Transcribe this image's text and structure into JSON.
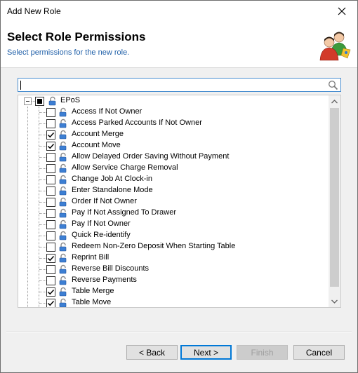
{
  "window": {
    "title": "Add New Role"
  },
  "header": {
    "title": "Select Role Permissions",
    "subtitle": "Select permissions for the new role.",
    "icon": "users-role-icon"
  },
  "search": {
    "value": "",
    "icon": "search-icon"
  },
  "tree": {
    "root": {
      "label": "EPoS",
      "expanded": true,
      "check_state": "partial"
    },
    "items": [
      {
        "label": "Access If Not Owner",
        "checked": false
      },
      {
        "label": "Access Parked Accounts If Not Owner",
        "checked": false
      },
      {
        "label": "Account Merge",
        "checked": true
      },
      {
        "label": "Account Move",
        "checked": true
      },
      {
        "label": "Allow Delayed Order Saving Without Payment",
        "checked": false
      },
      {
        "label": "Allow Service Charge Removal",
        "checked": false
      },
      {
        "label": "Change Job At Clock-in",
        "checked": false
      },
      {
        "label": "Enter Standalone Mode",
        "checked": false
      },
      {
        "label": "Order If Not Owner",
        "checked": false
      },
      {
        "label": "Pay If Not Assigned To Drawer",
        "checked": false
      },
      {
        "label": "Pay If Not Owner",
        "checked": false
      },
      {
        "label": "Quick Re-identify",
        "checked": false
      },
      {
        "label": "Redeem Non-Zero Deposit When Starting Table",
        "checked": false
      },
      {
        "label": "Reprint Bill",
        "checked": true
      },
      {
        "label": "Reverse Bill Discounts",
        "checked": false
      },
      {
        "label": "Reverse Payments",
        "checked": false
      },
      {
        "label": "Table Merge",
        "checked": true
      },
      {
        "label": "Table Move",
        "checked": true
      }
    ]
  },
  "buttons": {
    "back": "< Back",
    "next": "Next >",
    "finish": "Finish",
    "cancel": "Cancel"
  },
  "colors": {
    "accent": "#0078d7",
    "subtitle": "#1f5fa8",
    "check": "#000000"
  }
}
